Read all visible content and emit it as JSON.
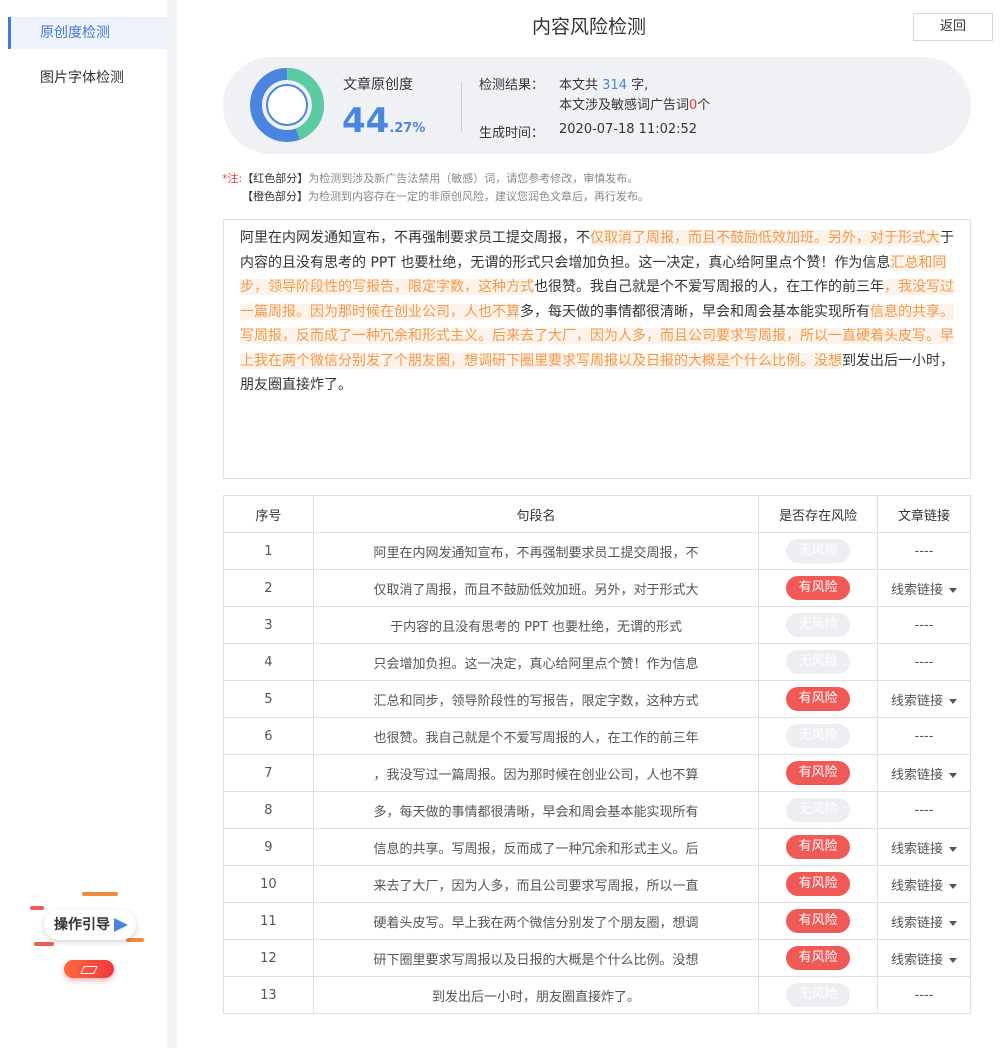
{
  "sidebar": {
    "items": [
      {
        "label": "原创度检测",
        "active": true
      },
      {
        "label": "图片字体检测",
        "active": false
      }
    ],
    "guide_label": "操作引导"
  },
  "header": {
    "title": "内容风险检测",
    "back_label": "返回"
  },
  "summary": {
    "orig_label": "文章原创度",
    "orig_int": "44",
    "orig_decimal": ".27%",
    "originality_percent": 44.27,
    "result_label": "检测结果：",
    "count_prefix": "本文共",
    "word_count": "314",
    "count_suffix": "字,",
    "sensitive_prefix": "本文涉及敏感词广告词",
    "sensitive_count": "0",
    "sensitive_suffix": "个",
    "time_label": "生成时间：",
    "time_value": "2020-07-18 11:02:52",
    "ring_colors": {
      "blue": "#4a86e0",
      "green": "#5ccca0"
    }
  },
  "notes": {
    "prefix": "*注:",
    "red_key": "【红色部分】",
    "red_text": "为检测到涉及新广告法禁用（敏感）词，请您参考修改，审慎发布。",
    "orange_key": "【橙色部分】",
    "orange_text": "为检测到内容存在一定的非原创风险，建议您润色文章后，再行发布。"
  },
  "article": {
    "segments": [
      {
        "text": "阿里在内网发通知宣布，不再强制要求员工提交周报，不",
        "risk": false
      },
      {
        "text": "仅取消了周报，而且不鼓励低效加班。另外，对于形式大",
        "risk": true
      },
      {
        "text": "于内容的且没有思考的 PPT 也要杜绝，无谓的形式",
        "risk": false
      },
      {
        "text": "只会增加负担。这一决定，真心给阿里点个赞！作为信息",
        "risk": false
      },
      {
        "text": "汇总和同步，领导阶段性的写报告，限定字数，这种方式",
        "risk": true
      },
      {
        "text": "也很赞。我自己就是个不爱写周报的人，在工作的前三年",
        "risk": false
      },
      {
        "text": "，我没写过一篇周报。因为那时候在创业公司，人也不算",
        "risk": true
      },
      {
        "text": "多，每天做的事情都很清晰，早会和周会基本能实现所有",
        "risk": false
      },
      {
        "text": "信息的共享。写周报，反而成了一种冗余和形式主义。后",
        "risk": true
      },
      {
        "text": "来去了大厂，因为人多，而且公司要求写周报，所以一直",
        "risk": true
      },
      {
        "text": "硬着头皮写。早上我在两个微信分别发了个朋友圈，想调",
        "risk": true
      },
      {
        "text": "研下圈里要求写周报以及日报的大概是个什么比例。没想",
        "risk": true
      },
      {
        "text": "到发出后一小时，朋友圈直接炸了。",
        "risk": false
      }
    ]
  },
  "table": {
    "headers": [
      "序号",
      "句段名",
      "是否存在风险",
      "文章链接"
    ],
    "rows": [
      {
        "no": "1",
        "text": "阿里在内网发通知宣布，不再强制要求员工提交周报，不",
        "risk": "无风险",
        "link": "----"
      },
      {
        "no": "2",
        "text": "仅取消了周报，而且不鼓励低效加班。另外，对于形式大",
        "risk": "有风险",
        "link": "线索链接"
      },
      {
        "no": "3",
        "text": "于内容的且没有思考的 PPT 也要杜绝，无谓的形式",
        "risk": "无风险",
        "link": "----"
      },
      {
        "no": "4",
        "text": "只会增加负担。这一决定，真心给阿里点个赞！作为信息",
        "risk": "无风险",
        "link": "----"
      },
      {
        "no": "5",
        "text": "汇总和同步，领导阶段性的写报告，限定字数，这种方式",
        "risk": "有风险",
        "link": "线索链接"
      },
      {
        "no": "6",
        "text": "也很赞。我自己就是个不爱写周报的人，在工作的前三年",
        "risk": "无风险",
        "link": "----"
      },
      {
        "no": "7",
        "text": "，我没写过一篇周报。因为那时候在创业公司，人也不算",
        "risk": "有风险",
        "link": "线索链接"
      },
      {
        "no": "8",
        "text": "多，每天做的事情都很清晰，早会和周会基本能实现所有",
        "risk": "无风险",
        "link": "----"
      },
      {
        "no": "9",
        "text": "信息的共享。写周报，反而成了一种冗余和形式主义。后",
        "risk": "有风险",
        "link": "线索链接"
      },
      {
        "no": "10",
        "text": "来去了大厂，因为人多，而且公司要求写周报，所以一直",
        "risk": "有风险",
        "link": "线索链接"
      },
      {
        "no": "11",
        "text": "硬着头皮写。早上我在两个微信分别发了个朋友圈，想调",
        "risk": "有风险",
        "link": "线索链接"
      },
      {
        "no": "12",
        "text": "研下圈里要求写周报以及日报的大概是个什么比例。没想",
        "risk": "有风险",
        "link": "线索链接"
      },
      {
        "no": "13",
        "text": "到发出后一小时，朋友圈直接炸了。",
        "risk": "无风险",
        "link": "----"
      }
    ]
  }
}
